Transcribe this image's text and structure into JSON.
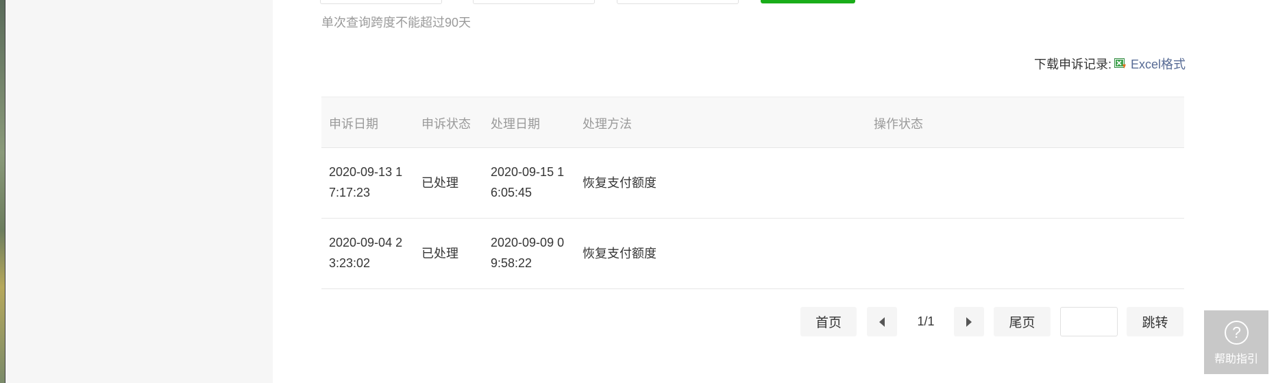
{
  "filters": {
    "hint": "单次查询跨度不能超过90天"
  },
  "download": {
    "label": "下载申诉记录:",
    "icon": "excel-icon",
    "link_text": "Excel格式"
  },
  "table": {
    "headers": {
      "date": "申诉日期",
      "status": "申诉状态",
      "process_date": "处理日期",
      "method": "处理方法",
      "op_status": "操作状态"
    },
    "rows": [
      {
        "date": "2020-09-13 17:17:23",
        "status": "已处理",
        "process_date": "2020-09-15 16:05:45",
        "method": "恢复支付额度",
        "op_status": ""
      },
      {
        "date": "2020-09-04 23:23:02",
        "status": "已处理",
        "process_date": "2020-09-09 09:58:22",
        "method": "恢复支付额度",
        "op_status": ""
      }
    ]
  },
  "pagination": {
    "first": "首页",
    "page_indicator": "1/1",
    "last": "尾页",
    "jump_value": "",
    "jump": "跳转"
  },
  "help": {
    "icon": "?",
    "label": "帮助指引"
  },
  "colors": {
    "accent_green": "#1aad19",
    "link_blue": "#576b95",
    "header_bg": "#f8f8f8"
  }
}
